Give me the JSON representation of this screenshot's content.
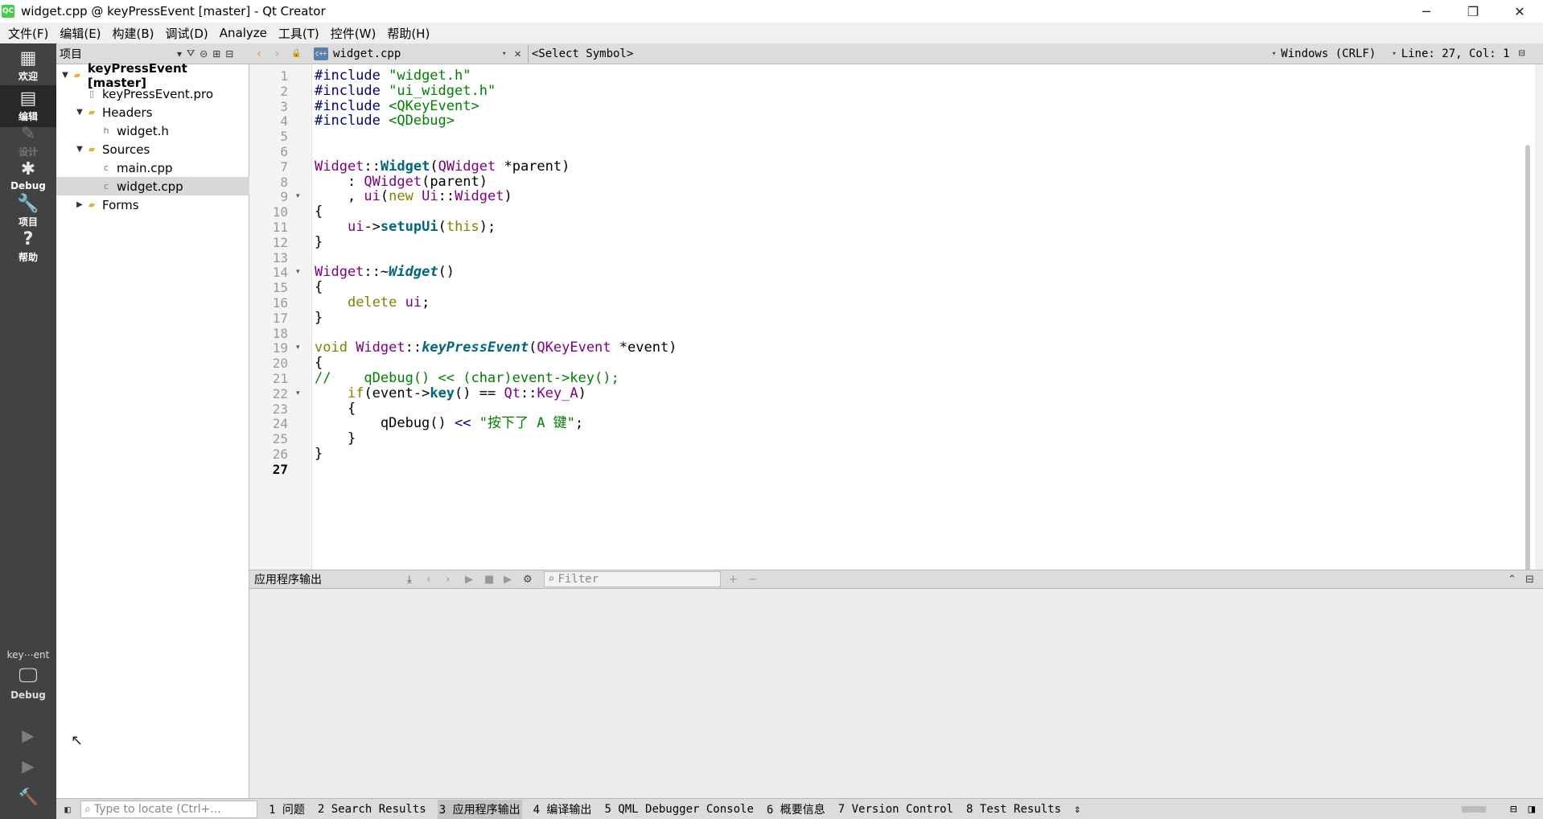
{
  "window": {
    "title": "widget.cpp @ keyPressEvent [master] - Qt Creator",
    "app_icon": "QC",
    "min_glyph": "─",
    "max_glyph": "❐",
    "close_glyph": "✕"
  },
  "menubar": {
    "items": [
      "文件(F)",
      "编辑(E)",
      "构建(B)",
      "调试(D)",
      "Analyze",
      "工具(T)",
      "控件(W)",
      "帮助(H)"
    ]
  },
  "modebar": {
    "modes": [
      {
        "label": "欢迎",
        "icon": "grid-icon",
        "glyph": "▦",
        "active": false,
        "disabled": false
      },
      {
        "label": "编辑",
        "icon": "edit-icon",
        "glyph": "▤",
        "active": true,
        "disabled": false
      },
      {
        "label": "设计",
        "icon": "design-icon",
        "glyph": "✎",
        "active": false,
        "disabled": true
      },
      {
        "label": "Debug",
        "icon": "bug-icon",
        "glyph": "✱",
        "active": false,
        "disabled": false
      },
      {
        "label": "项目",
        "icon": "wrench-icon",
        "glyph": "🔧",
        "active": false,
        "disabled": false
      },
      {
        "label": "帮助",
        "icon": "help-icon",
        "glyph": "?",
        "active": false,
        "disabled": false
      }
    ],
    "kit": {
      "project": "key⋯ent",
      "config": "Debug",
      "monitor_glyph": "🖵"
    },
    "run_glyph": "▶",
    "debug_run_glyph": "▶",
    "build_glyph": "🔨"
  },
  "project_pane": {
    "selector_label": "项目",
    "filter_glyph": "⛛",
    "link_glyph": "⊝",
    "split_glyph": "⊞",
    "close_glyph": "⊟",
    "tree": [
      {
        "label": "keyPressEvent [master]",
        "level": 0,
        "arrow": "▼",
        "icon": "project-folder-icon",
        "glyph": "▰",
        "bold": true,
        "selected": false
      },
      {
        "label": "keyPressEvent.pro",
        "level": 1,
        "arrow": "",
        "icon": "pro-file-icon",
        "glyph": "▯",
        "bold": false,
        "selected": false
      },
      {
        "label": "Headers",
        "level": 1,
        "arrow": "▼",
        "icon": "headers-folder-icon",
        "glyph": "▰",
        "bold": false,
        "selected": false
      },
      {
        "label": "widget.h",
        "level": 2,
        "arrow": "",
        "icon": "header-file-icon",
        "glyph": "h",
        "bold": false,
        "selected": false
      },
      {
        "label": "Sources",
        "level": 1,
        "arrow": "▼",
        "icon": "sources-folder-icon",
        "glyph": "▰",
        "bold": false,
        "selected": false
      },
      {
        "label": "main.cpp",
        "level": 2,
        "arrow": "",
        "icon": "cpp-file-icon",
        "glyph": "c",
        "bold": false,
        "selected": false
      },
      {
        "label": "widget.cpp",
        "level": 2,
        "arrow": "",
        "icon": "cpp-file-icon",
        "glyph": "c",
        "bold": false,
        "selected": true
      },
      {
        "label": "Forms",
        "level": 1,
        "arrow": "▶",
        "icon": "forms-folder-icon",
        "glyph": "▰",
        "bold": false,
        "selected": false
      }
    ]
  },
  "editor_toolbar": {
    "back_glyph": "‹",
    "forward_glyph": "›",
    "lock_glyph": "🔒",
    "file_icon": "c++",
    "file_name": "widget.cpp",
    "dropdown_glyph": "▾",
    "close_glyph": "✕",
    "symbol": "<Select Symbol>",
    "encoding": "Windows (CRLF)",
    "position": "Line: 27, Col: 1",
    "split_glyph": "⊟"
  },
  "editor": {
    "current_line": 27,
    "fold_glyph": "▾",
    "lines": [
      {
        "n": "1",
        "fold": false,
        "segs": [
          {
            "t": "#include ",
            "c": "k-pre"
          },
          {
            "t": "\"widget.h\"",
            "c": "k-str"
          }
        ]
      },
      {
        "n": "2",
        "fold": false,
        "segs": [
          {
            "t": "#include ",
            "c": "k-pre"
          },
          {
            "t": "\"ui_widget.h\"",
            "c": "k-str"
          }
        ]
      },
      {
        "n": "3",
        "fold": false,
        "segs": [
          {
            "t": "#include ",
            "c": "k-pre"
          },
          {
            "t": "<QKeyEvent>",
            "c": "k-str"
          }
        ]
      },
      {
        "n": "4",
        "fold": false,
        "segs": [
          {
            "t": "#include ",
            "c": "k-pre"
          },
          {
            "t": "<QDebug>",
            "c": "k-str"
          }
        ]
      },
      {
        "n": "5",
        "fold": false,
        "segs": []
      },
      {
        "n": "6",
        "fold": false,
        "segs": []
      },
      {
        "n": "7",
        "fold": false,
        "segs": [
          {
            "t": "Widget",
            "c": "k-cls"
          },
          {
            "t": "::",
            "c": "k-op"
          },
          {
            "t": "Widget",
            "c": "k-fn"
          },
          {
            "t": "(",
            "c": "k-op"
          },
          {
            "t": "QWidget",
            "c": "k-cls"
          },
          {
            "t": " *parent)",
            "c": "k-op"
          }
        ]
      },
      {
        "n": "8",
        "fold": false,
        "segs": [
          {
            "t": "    : ",
            "c": "k-op"
          },
          {
            "t": "QWidget",
            "c": "k-cls"
          },
          {
            "t": "(parent)",
            "c": "k-op"
          }
        ]
      },
      {
        "n": "9",
        "fold": true,
        "segs": [
          {
            "t": "    , ",
            "c": "k-op"
          },
          {
            "t": "ui",
            "c": "k-cls"
          },
          {
            "t": "(",
            "c": "k-op"
          },
          {
            "t": "new ",
            "c": "k-kw"
          },
          {
            "t": "Ui",
            "c": "k-cls"
          },
          {
            "t": "::",
            "c": "k-op"
          },
          {
            "t": "Widget",
            "c": "k-cls"
          },
          {
            "t": ")",
            "c": "k-op"
          }
        ]
      },
      {
        "n": "10",
        "fold": false,
        "segs": [
          {
            "t": "{",
            "c": "k-op"
          }
        ]
      },
      {
        "n": "11",
        "fold": false,
        "segs": [
          {
            "t": "    ",
            "c": "k-op"
          },
          {
            "t": "ui",
            "c": "k-cls"
          },
          {
            "t": "->",
            "c": "k-op"
          },
          {
            "t": "setupUi",
            "c": "k-fn"
          },
          {
            "t": "(",
            "c": "k-op"
          },
          {
            "t": "this",
            "c": "k-kw"
          },
          {
            "t": ");",
            "c": "k-op"
          }
        ]
      },
      {
        "n": "12",
        "fold": false,
        "segs": [
          {
            "t": "}",
            "c": "k-op"
          }
        ]
      },
      {
        "n": "13",
        "fold": false,
        "segs": []
      },
      {
        "n": "14",
        "fold": true,
        "segs": [
          {
            "t": "Widget",
            "c": "k-cls"
          },
          {
            "t": "::~",
            "c": "k-op"
          },
          {
            "t": "Widget",
            "c": "k-fni"
          },
          {
            "t": "()",
            "c": "k-op"
          }
        ]
      },
      {
        "n": "15",
        "fold": false,
        "segs": [
          {
            "t": "{",
            "c": "k-op"
          }
        ]
      },
      {
        "n": "16",
        "fold": false,
        "segs": [
          {
            "t": "    ",
            "c": "k-op"
          },
          {
            "t": "delete ",
            "c": "k-kw"
          },
          {
            "t": "ui",
            "c": "k-cls"
          },
          {
            "t": ";",
            "c": "k-op"
          }
        ]
      },
      {
        "n": "17",
        "fold": false,
        "segs": [
          {
            "t": "}",
            "c": "k-op"
          }
        ]
      },
      {
        "n": "18",
        "fold": false,
        "segs": []
      },
      {
        "n": "19",
        "fold": true,
        "segs": [
          {
            "t": "void ",
            "c": "k-kw"
          },
          {
            "t": "Widget",
            "c": "k-cls"
          },
          {
            "t": "::",
            "c": "k-op"
          },
          {
            "t": "keyPressEvent",
            "c": "k-fni"
          },
          {
            "t": "(",
            "c": "k-op"
          },
          {
            "t": "QKeyEvent",
            "c": "k-cls"
          },
          {
            "t": " *event)",
            "c": "k-op"
          }
        ]
      },
      {
        "n": "20",
        "fold": false,
        "segs": [
          {
            "t": "{",
            "c": "k-op"
          }
        ]
      },
      {
        "n": "21",
        "fold": false,
        "segs": [
          {
            "t": "//    qDebug() << (char)event->key();",
            "c": "k-cm"
          }
        ]
      },
      {
        "n": "22",
        "fold": true,
        "segs": [
          {
            "t": "    ",
            "c": "k-op"
          },
          {
            "t": "if",
            "c": "k-kw"
          },
          {
            "t": "(event->",
            "c": "k-op"
          },
          {
            "t": "key",
            "c": "k-fn"
          },
          {
            "t": "() == ",
            "c": "k-op"
          },
          {
            "t": "Qt",
            "c": "k-cls"
          },
          {
            "t": "::",
            "c": "k-op"
          },
          {
            "t": "Key_A",
            "c": "k-cls"
          },
          {
            "t": ")",
            "c": "k-op"
          }
        ]
      },
      {
        "n": "23",
        "fold": false,
        "segs": [
          {
            "t": "    {",
            "c": "k-op"
          }
        ]
      },
      {
        "n": "24",
        "fold": false,
        "segs": [
          {
            "t": "        qDebug() ",
            "c": "k-op"
          },
          {
            "t": "<< ",
            "c": "k-pre"
          },
          {
            "t": "\"按下了 A 键\"",
            "c": "k-str"
          },
          {
            "t": ";",
            "c": "k-op"
          }
        ]
      },
      {
        "n": "25",
        "fold": false,
        "segs": [
          {
            "t": "    }",
            "c": "k-op"
          }
        ]
      },
      {
        "n": "26",
        "fold": false,
        "segs": [
          {
            "t": "}",
            "c": "k-op"
          }
        ]
      },
      {
        "n": "27",
        "fold": false,
        "segs": []
      }
    ]
  },
  "output_pane": {
    "title": "应用程序输出",
    "filter_placeholder": "Filter",
    "search_glyph": "⌕",
    "tools": [
      {
        "name": "attach-icon",
        "glyph": "⤓",
        "on": true
      },
      {
        "name": "prev-icon",
        "glyph": "‹",
        "on": false
      },
      {
        "name": "next-icon",
        "glyph": "›",
        "on": false
      },
      {
        "name": "rerun-icon",
        "glyph": "▶",
        "on": false
      },
      {
        "name": "stop-icon",
        "glyph": "■",
        "on": false
      },
      {
        "name": "debug-icon",
        "glyph": "▶",
        "on": false
      },
      {
        "name": "settings-icon",
        "glyph": "⚙",
        "on": true
      }
    ],
    "zoom_in_glyph": "+",
    "zoom_out_glyph": "−",
    "collapse_glyph": "⌃",
    "maximize_glyph": "⊟"
  },
  "statusbar": {
    "sidebar_toggle_glyph": "◧",
    "locator_placeholder": "Type to locate (Ctrl+...",
    "locator_glyph": "⌕",
    "tabs": [
      {
        "label": "1 问题",
        "active": false
      },
      {
        "label": "2 Search Results",
        "active": false
      },
      {
        "label": "3 应用程序输出",
        "active": true
      },
      {
        "label": "4 编译输出",
        "active": false
      },
      {
        "label": "5 QML Debugger Console",
        "active": false
      },
      {
        "label": "6 概要信息",
        "active": false
      },
      {
        "label": "7 Version Control",
        "active": false
      },
      {
        "label": "8 Test Results",
        "active": false
      }
    ],
    "more_glyph": "⇕",
    "progress": 0.0,
    "right_glyph_1": "⊟",
    "right_glyph_2": "◨"
  },
  "cursor_glyph": "↖"
}
